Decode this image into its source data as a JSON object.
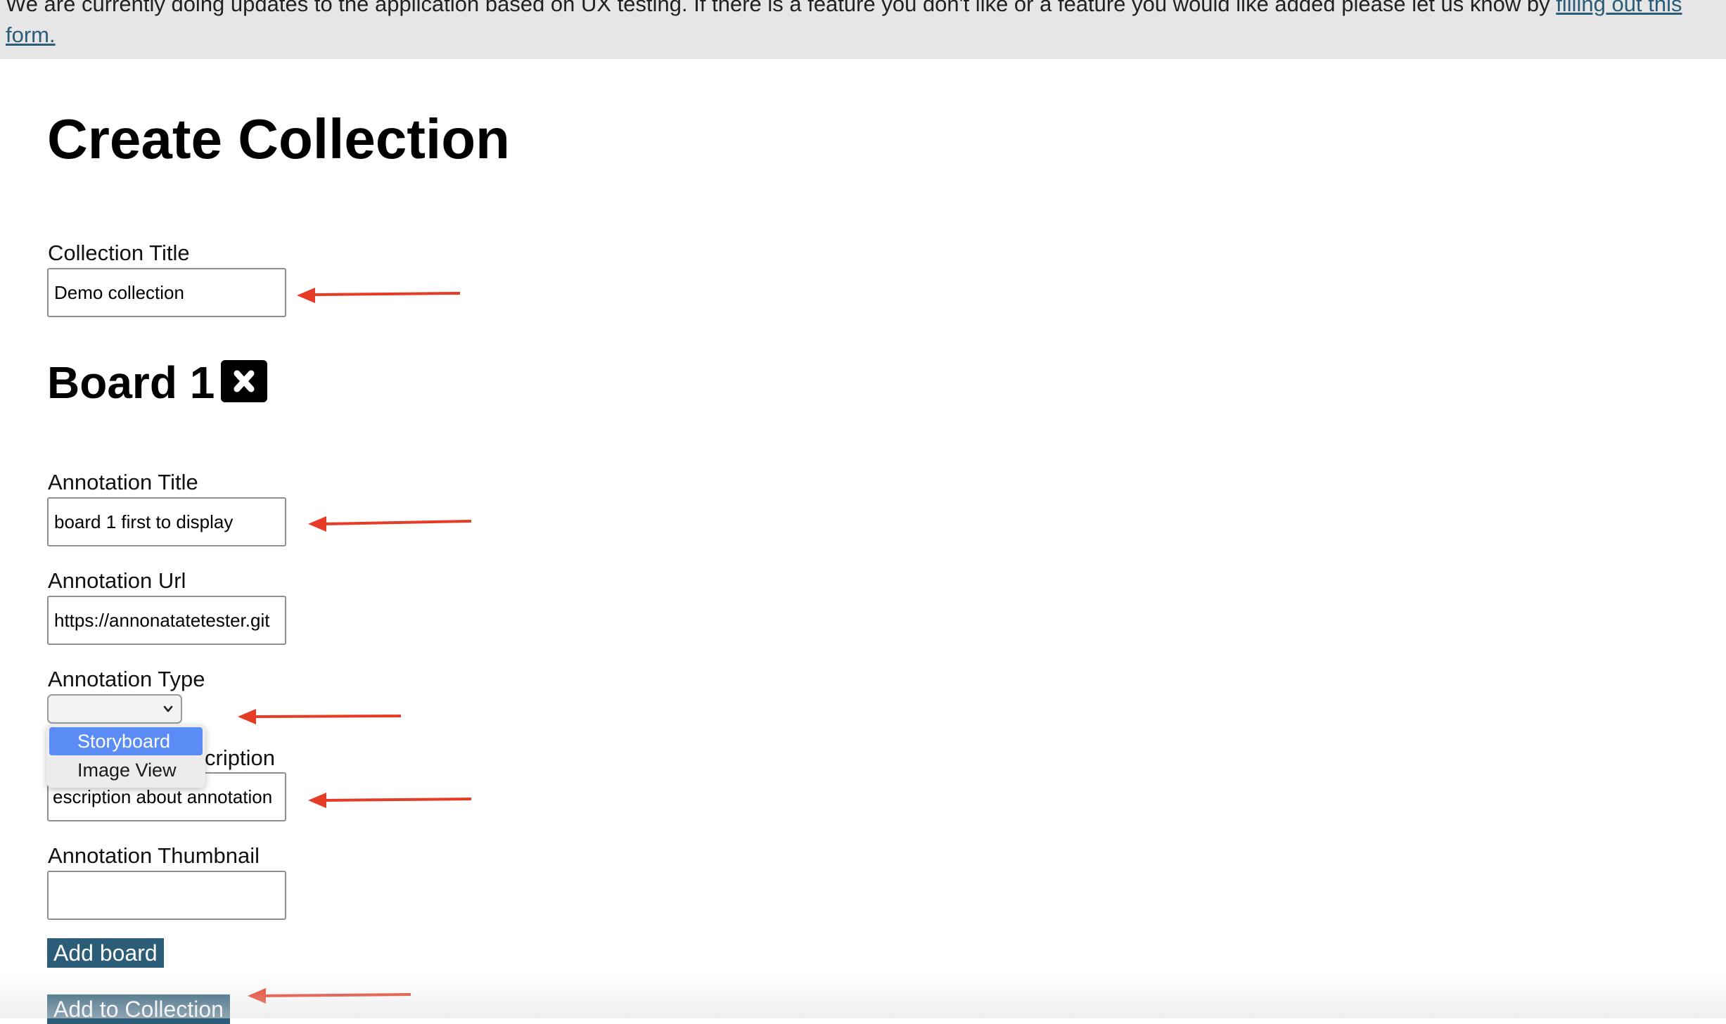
{
  "banner": {
    "text": "We are currently doing updates to the application based on UX testing. If there is a feature you don't like or a feature you would like added please let us know by ",
    "link": "filling out this form."
  },
  "page": {
    "title": "Create Collection"
  },
  "collection": {
    "title_label": "Collection Title",
    "title_value": "Demo collection"
  },
  "board": {
    "heading": "Board 1",
    "remove_icon": "close-x-icon",
    "annotation_title_label": "Annotation Title",
    "annotation_title_value": "board 1 first to display",
    "annotation_url_label": "Annotation Url",
    "annotation_url_value": "https://annonatatetester.git",
    "annotation_type_label": "Annotation Type",
    "annotation_type_value": "",
    "annotation_type_options": [
      "Storyboard",
      "Image View"
    ],
    "annotation_type_highlighted": "Storyboard",
    "annotation_description_label_visible": "cription",
    "annotation_description_value": "escription about annotation",
    "annotation_thumbnail_label": "Annotation Thumbnail",
    "annotation_thumbnail_value": ""
  },
  "buttons": {
    "add_board": "Add board",
    "add_to_collection": "Add to Collection"
  },
  "colors": {
    "banner_bg": "#e6e6e6",
    "link": "#2c5d78",
    "button_bg": "#2c5d78",
    "dropdown_highlight": "#5b8cf6",
    "annotation_arrow": "#e53c27"
  }
}
